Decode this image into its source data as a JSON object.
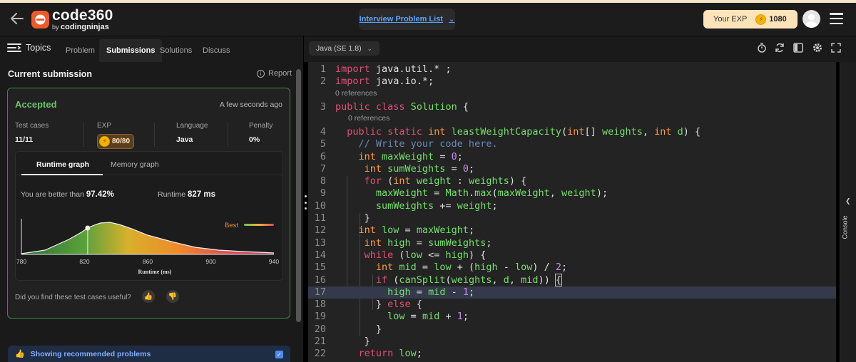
{
  "header": {
    "logo_title": "code360",
    "logo_sub_prefix": "by ",
    "logo_sub_brand": "codingninjas",
    "interview_list": "Interview Problem List",
    "exp_label": "Your EXP",
    "exp_value": "1080"
  },
  "tabs": {
    "topics": "Topics",
    "items": [
      "Problem",
      "Submissions",
      "Solutions",
      "Discuss"
    ],
    "active": "Submissions"
  },
  "editor_toolbar": {
    "language": "Java (SE 1.8)",
    "icons": [
      "timer-icon",
      "refresh-icon",
      "layout-icon",
      "settings-icon",
      "fullscreen-icon"
    ]
  },
  "submission": {
    "title": "Current submission",
    "report": "Report",
    "status": "Accepted",
    "time_ago": "A few seconds ago",
    "stats": {
      "test_cases_label": "Test cases",
      "test_cases_value": "11/11",
      "exp_label": "EXP",
      "exp_value": "80/80",
      "language_label": "Language",
      "language_value": "Java",
      "penalty_label": "Penalty",
      "penalty_value": "0%"
    },
    "graph": {
      "tab_runtime": "Runtime graph",
      "tab_memory": "Memory graph",
      "better_label": "You are better than",
      "better_value": "97.42%",
      "runtime_label": "Runtime",
      "runtime_value": "827 ms",
      "legend_best": "Best",
      "xlabel": "Runtime (ms)"
    },
    "useful_question": "Did you find these test cases useful?",
    "recommended": "Showing recommended problems"
  },
  "chart_data": {
    "type": "area",
    "xlabel": "Runtime (ms)",
    "ylabel": "",
    "xlim": [
      780,
      940
    ],
    "x_ticks": [
      780,
      820,
      860,
      900,
      940
    ],
    "x": [
      780,
      795,
      810,
      818,
      822,
      826,
      830,
      836,
      842,
      850,
      860,
      875,
      890,
      905,
      920,
      935,
      940
    ],
    "y": [
      0.02,
      0.12,
      0.42,
      0.62,
      0.74,
      0.82,
      0.88,
      0.9,
      0.84,
      0.72,
      0.54,
      0.36,
      0.2,
      0.12,
      0.08,
      0.05,
      0.04
    ],
    "marker_x": 822,
    "legend": "Best",
    "grid": false
  },
  "code": {
    "refs": [
      "0 references",
      "0 references"
    ],
    "lines": [
      [
        [
          "kw",
          "import "
        ],
        [
          "pl",
          "java.util.* ;"
        ]
      ],
      [
        [
          "kw",
          "import "
        ],
        [
          "pl",
          "java.io.*;"
        ]
      ],
      [
        [
          "kw",
          "public "
        ],
        [
          "kw",
          "class "
        ],
        [
          "id",
          "Solution "
        ],
        [
          "pl",
          "{"
        ]
      ],
      [
        [
          "kw",
          "  public "
        ],
        [
          "kw",
          "static "
        ],
        [
          "tp",
          "int "
        ],
        [
          "id",
          "leastWeightCapacity"
        ],
        [
          "pl",
          "("
        ],
        [
          "tp",
          "int"
        ],
        [
          "pl",
          "[] "
        ],
        [
          "id",
          "weights"
        ],
        [
          "pl",
          ", "
        ],
        [
          "tp",
          "int "
        ],
        [
          "id",
          "d"
        ],
        [
          "pl",
          ") {"
        ]
      ],
      [
        [
          "cm",
          "    // Write your code here."
        ]
      ],
      [
        [
          "tp",
          "    int "
        ],
        [
          "id",
          "maxWeight "
        ],
        [
          "pl",
          "= "
        ],
        [
          "num-lit",
          "0"
        ],
        [
          "pl",
          ";"
        ]
      ],
      [
        [
          "tp",
          "     int "
        ],
        [
          "id",
          "sumWeights "
        ],
        [
          "pl",
          "= "
        ],
        [
          "num-lit",
          "0"
        ],
        [
          "pl",
          ";"
        ]
      ],
      [
        [
          "kw",
          "     for "
        ],
        [
          "pl",
          "("
        ],
        [
          "tp",
          "int "
        ],
        [
          "id",
          "weight "
        ],
        [
          "pl",
          ": "
        ],
        [
          "id",
          "weights"
        ],
        [
          "pl",
          ") {"
        ]
      ],
      [
        [
          "id",
          "       maxWeight "
        ],
        [
          "pl",
          "= "
        ],
        [
          "id",
          "Math"
        ],
        [
          "pl",
          "."
        ],
        [
          "id",
          "max"
        ],
        [
          "pl",
          "("
        ],
        [
          "id",
          "maxWeight"
        ],
        [
          "pl",
          ", "
        ],
        [
          "id",
          "weight"
        ],
        [
          "pl",
          ");"
        ]
      ],
      [
        [
          "id",
          "       sumWeights "
        ],
        [
          "pl",
          "+= "
        ],
        [
          "id",
          "weight"
        ],
        [
          "pl",
          ";"
        ]
      ],
      [
        [
          "pl",
          "     }"
        ]
      ],
      [
        [
          "tp",
          "    int "
        ],
        [
          "id",
          "low "
        ],
        [
          "pl",
          "= "
        ],
        [
          "id",
          "maxWeight"
        ],
        [
          "pl",
          ";"
        ]
      ],
      [
        [
          "tp",
          "     int "
        ],
        [
          "id",
          "high "
        ],
        [
          "pl",
          "= "
        ],
        [
          "id",
          "sumWeights"
        ],
        [
          "pl",
          ";"
        ]
      ],
      [
        [
          "kw",
          "     while "
        ],
        [
          "pl",
          "("
        ],
        [
          "id",
          "low "
        ],
        [
          "pl",
          "<= "
        ],
        [
          "id",
          "high"
        ],
        [
          "pl",
          ") {"
        ]
      ],
      [
        [
          "tp",
          "       int "
        ],
        [
          "id",
          "mid "
        ],
        [
          "pl",
          "= "
        ],
        [
          "id",
          "low "
        ],
        [
          "pl",
          "+ ("
        ],
        [
          "id",
          "high "
        ],
        [
          "pl",
          "- "
        ],
        [
          "id",
          "low"
        ],
        [
          "pl",
          ") / "
        ],
        [
          "num-lit",
          "2"
        ],
        [
          "pl",
          ";"
        ]
      ],
      [
        [
          "kw",
          "       if "
        ],
        [
          "pl",
          "("
        ],
        [
          "id",
          "canSplit"
        ],
        [
          "pl",
          "("
        ],
        [
          "id",
          "weights"
        ],
        [
          "pl",
          ", "
        ],
        [
          "id",
          "d"
        ],
        [
          "pl",
          ", "
        ],
        [
          "id",
          "mid"
        ],
        [
          "pl",
          ")) "
        ],
        [
          "pl",
          "{"
        ]
      ],
      [
        [
          "id",
          "         high "
        ],
        [
          "pl",
          "= "
        ],
        [
          "id",
          "mid "
        ],
        [
          "pl",
          "- "
        ],
        [
          "num-lit",
          "1"
        ],
        [
          "pl",
          ";"
        ]
      ],
      [
        [
          "pl",
          "       } "
        ],
        [
          "kw",
          "else "
        ],
        [
          "pl",
          "{"
        ]
      ],
      [
        [
          "id",
          "         low "
        ],
        [
          "pl",
          "= "
        ],
        [
          "id",
          "mid "
        ],
        [
          "pl",
          "+ "
        ],
        [
          "num-lit",
          "1"
        ],
        [
          "pl",
          ";"
        ]
      ],
      [
        [
          "pl",
          "       }"
        ]
      ],
      [
        [
          "pl",
          "     }"
        ]
      ],
      [
        [
          "kw",
          "    return "
        ],
        [
          "id",
          "low"
        ],
        [
          "pl",
          ";"
        ]
      ]
    ],
    "line_numbers": [
      "1",
      "2",
      "3",
      "4",
      "5",
      "6",
      "7",
      "8",
      "9",
      "10",
      "11",
      "12",
      "13",
      "14",
      "15",
      "16",
      "17",
      "18",
      "19",
      "20",
      "21",
      "22"
    ]
  },
  "console": {
    "label": "Console"
  }
}
